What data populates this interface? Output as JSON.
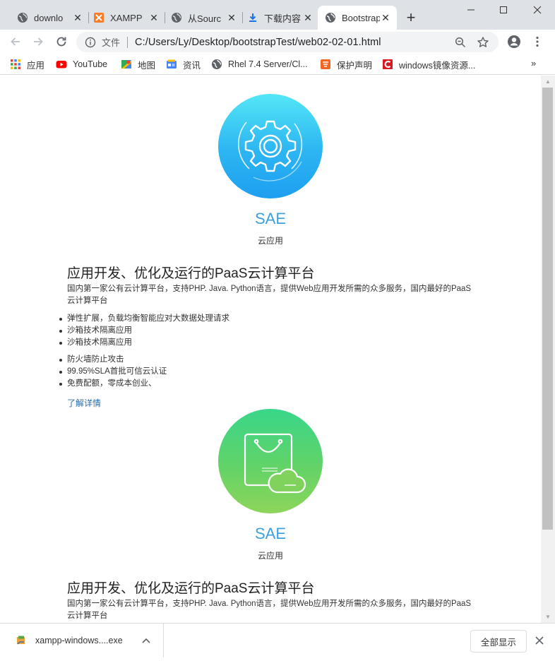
{
  "tabs": [
    {
      "label": "downlo",
      "icon": "globe-icon",
      "active": false
    },
    {
      "label": "XAMPP",
      "icon": "xampp-icon",
      "active": false
    },
    {
      "label": "从Sourc",
      "icon": "globe-icon",
      "active": false
    },
    {
      "label": "下载内容",
      "icon": "download-icon",
      "active": false
    },
    {
      "label": "Bootstrap",
      "icon": "globe-icon",
      "active": true
    }
  ],
  "address": {
    "scheme_label": "文件",
    "url": "C:/Users/Ly/Desktop/bootstrapTest/web02-02-01.html"
  },
  "bookmarks": [
    {
      "label": "应用",
      "icon": "apps-grid-icon"
    },
    {
      "label": "YouTube",
      "icon": "youtube-icon"
    },
    {
      "label": "地图",
      "icon": "maps-icon"
    },
    {
      "label": "资讯",
      "icon": "news-icon"
    },
    {
      "label": "Rhel 7.4 Server/Cl...",
      "icon": "globe-icon"
    },
    {
      "label": "保护声明",
      "icon": "protect-icon"
    },
    {
      "label": "windows镜像资源...",
      "icon": "c-logo-icon"
    }
  ],
  "sections": [
    {
      "name": "SAE",
      "subtitle": "云应用",
      "headline": "应用开发、优化及运行的PaaS云计算平台",
      "description": "国内第一家公有云计算平台，支持PHP. Java. Python语言，提供Web应用开发所需的众多服务，国内最好的PaaS云计算平台",
      "features_a": [
        "弹性扩展，负载均衡智能应对大数据处理请求",
        "沙箱技术隔离应用",
        "沙箱技术隔离应用"
      ],
      "features_b": [
        "防火墙防止攻击",
        "99.95%SLA首批可信云认证",
        "免费配额，零成本创业、"
      ],
      "more_link": "了解详情",
      "icon": "gear-icon"
    },
    {
      "name": "SAE",
      "subtitle": "云应用",
      "headline": "应用开发、优化及运行的PaaS云计算平台",
      "description": "国内第一家公有云计算平台，支持PHP. Java. Python语言，提供Web应用开发所需的众多服务，国内最好的PaaS云计算平台",
      "icon": "shopping-bag-cloud-icon"
    }
  ],
  "download": {
    "filename": "xampp-windows....exe",
    "show_all": "全部显示"
  },
  "colors": {
    "accent_blue": "#3ba0e0",
    "link_blue": "#2a6fb0"
  }
}
